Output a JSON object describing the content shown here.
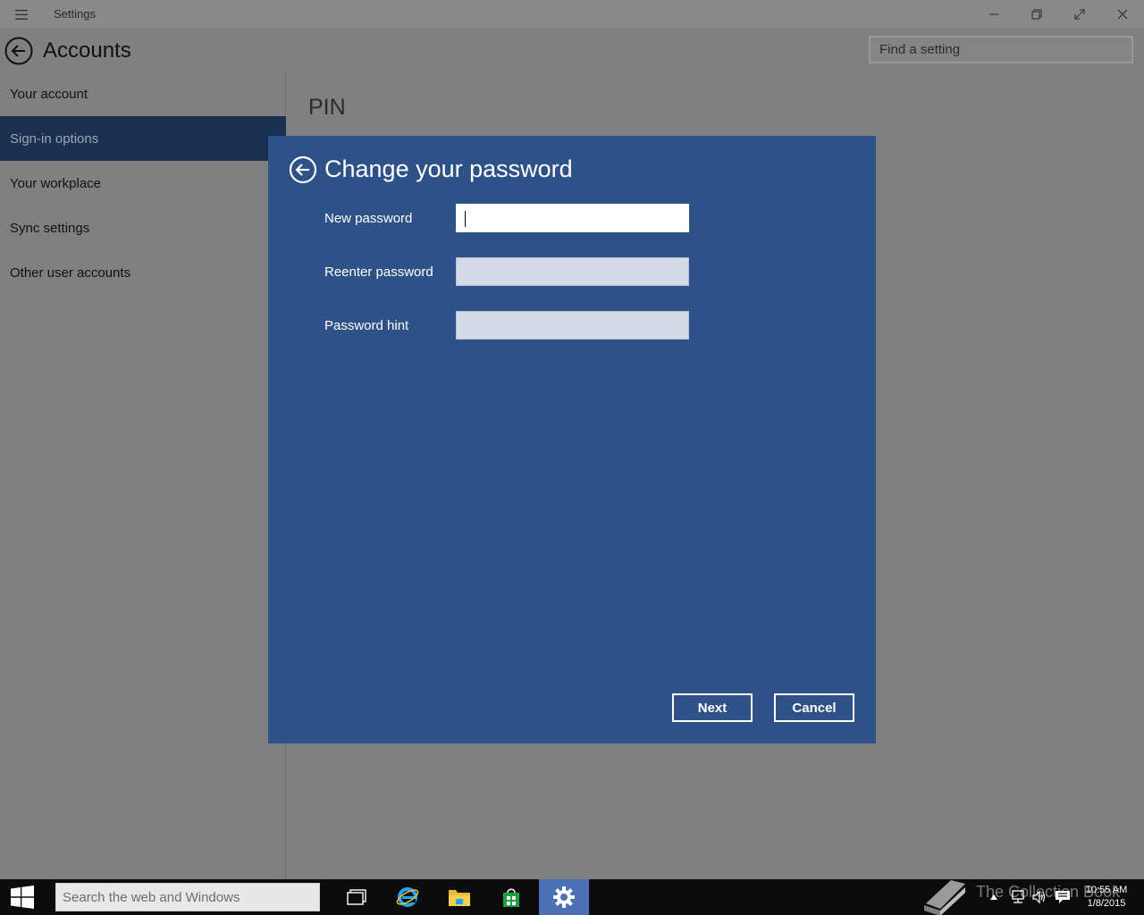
{
  "window": {
    "title": "Settings",
    "header_title": "Accounts"
  },
  "search": {
    "placeholder": "Find a setting"
  },
  "sidebar": {
    "items": [
      {
        "label": "Your account"
      },
      {
        "label": "Sign-in options",
        "selected": true
      },
      {
        "label": "Your workplace"
      },
      {
        "label": "Sync settings"
      },
      {
        "label": "Other user accounts"
      }
    ]
  },
  "content": {
    "heading": "PIN"
  },
  "dialog": {
    "title": "Change your password",
    "fields": [
      {
        "label": "New password",
        "value": ""
      },
      {
        "label": "Reenter password",
        "value": ""
      },
      {
        "label": "Password hint",
        "value": ""
      }
    ],
    "next_label": "Next",
    "cancel_label": "Cancel"
  },
  "taskbar": {
    "search_placeholder": "Search the web and Windows",
    "watermark": "The Collection Book",
    "time": "10:55 AM",
    "date": "1/8/2015"
  },
  "colors": {
    "dialog_bg": "#2e5287",
    "selected_nav": "#1b2f4f",
    "taskbar_active": "#4d6fb4"
  }
}
